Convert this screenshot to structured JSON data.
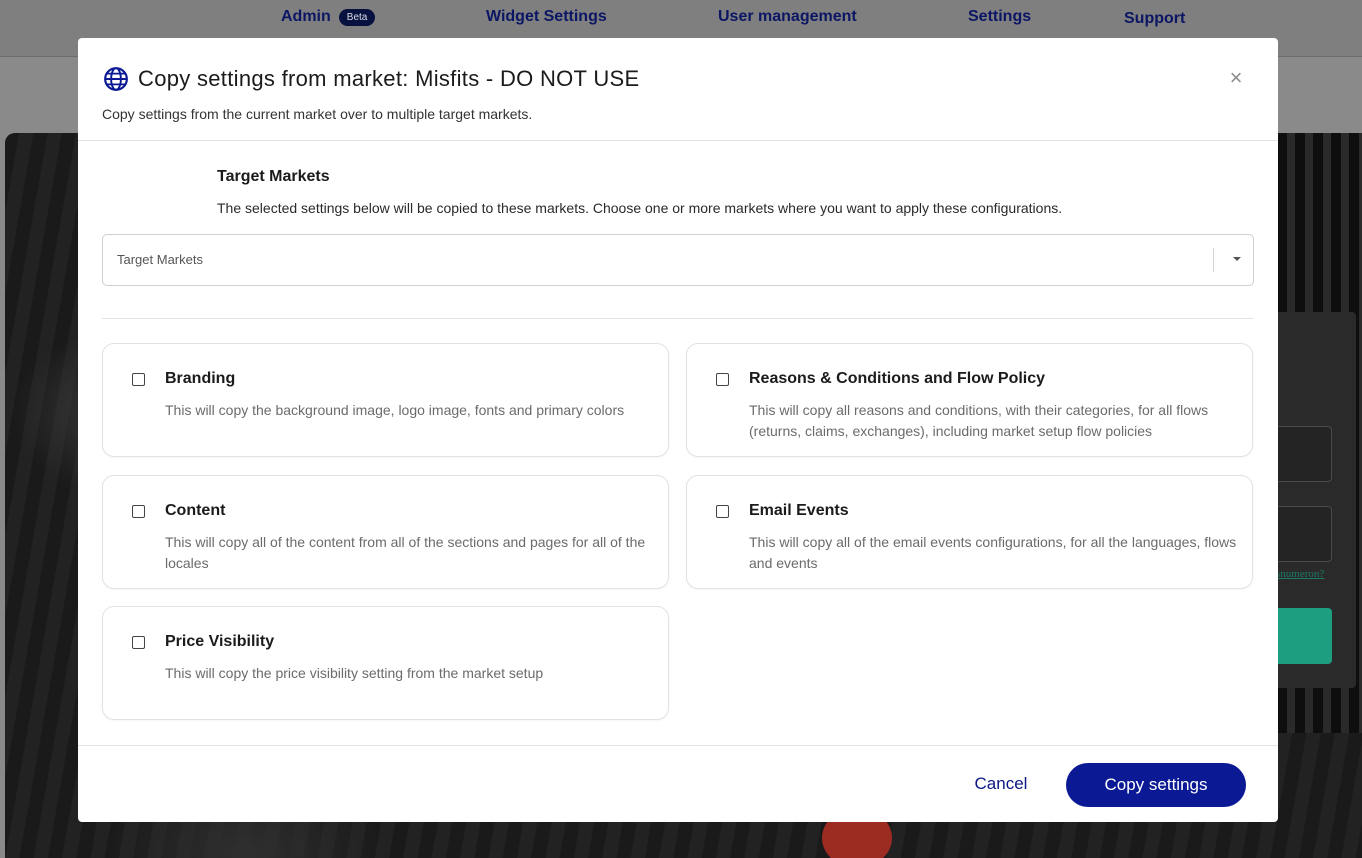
{
  "nav": {
    "admin": "Admin",
    "beta_badge": "Beta",
    "widget_settings": "Widget Settings",
    "user_management": "User management",
    "settings": "Settings",
    "support": "Support"
  },
  "background": {
    "login_link_fragment": "snumeron?"
  },
  "modal": {
    "icon": "globe-icon",
    "title": "Copy settings from market: Misfits - DO NOT USE",
    "subtitle": "Copy settings from the current market over to multiple target markets.",
    "close_symbol": "×",
    "target_markets": {
      "title": "Target Markets",
      "description": "The selected settings below will be copied to these markets. Choose one or more markets where you want to apply these configurations.",
      "placeholder": "Target Markets"
    },
    "options": [
      {
        "title": "Branding",
        "description": "This will copy the background image, logo image, fonts and primary colors",
        "checked": false
      },
      {
        "title": "Reasons & Conditions and Flow Policy",
        "description": "This will copy all reasons and conditions, with their categories, for all flows (returns, claims, exchanges), including market setup flow policies",
        "checked": false
      },
      {
        "title": "Content",
        "description": "This will copy all of the content from all of the sections and pages for all of the locales",
        "checked": false
      },
      {
        "title": "Email Events",
        "description": "This will copy all of the email events configurations, for all the languages, flows and events",
        "checked": false
      },
      {
        "title": "Price Visibility",
        "description": "This will copy the price visibility setting from the market setup",
        "checked": false
      }
    ],
    "footer": {
      "cancel": "Cancel",
      "copy": "Copy settings"
    }
  },
  "colors": {
    "primary_button": "#0b1a94",
    "nav_text": "#0b1664",
    "overlay": "#8a8a8a"
  }
}
